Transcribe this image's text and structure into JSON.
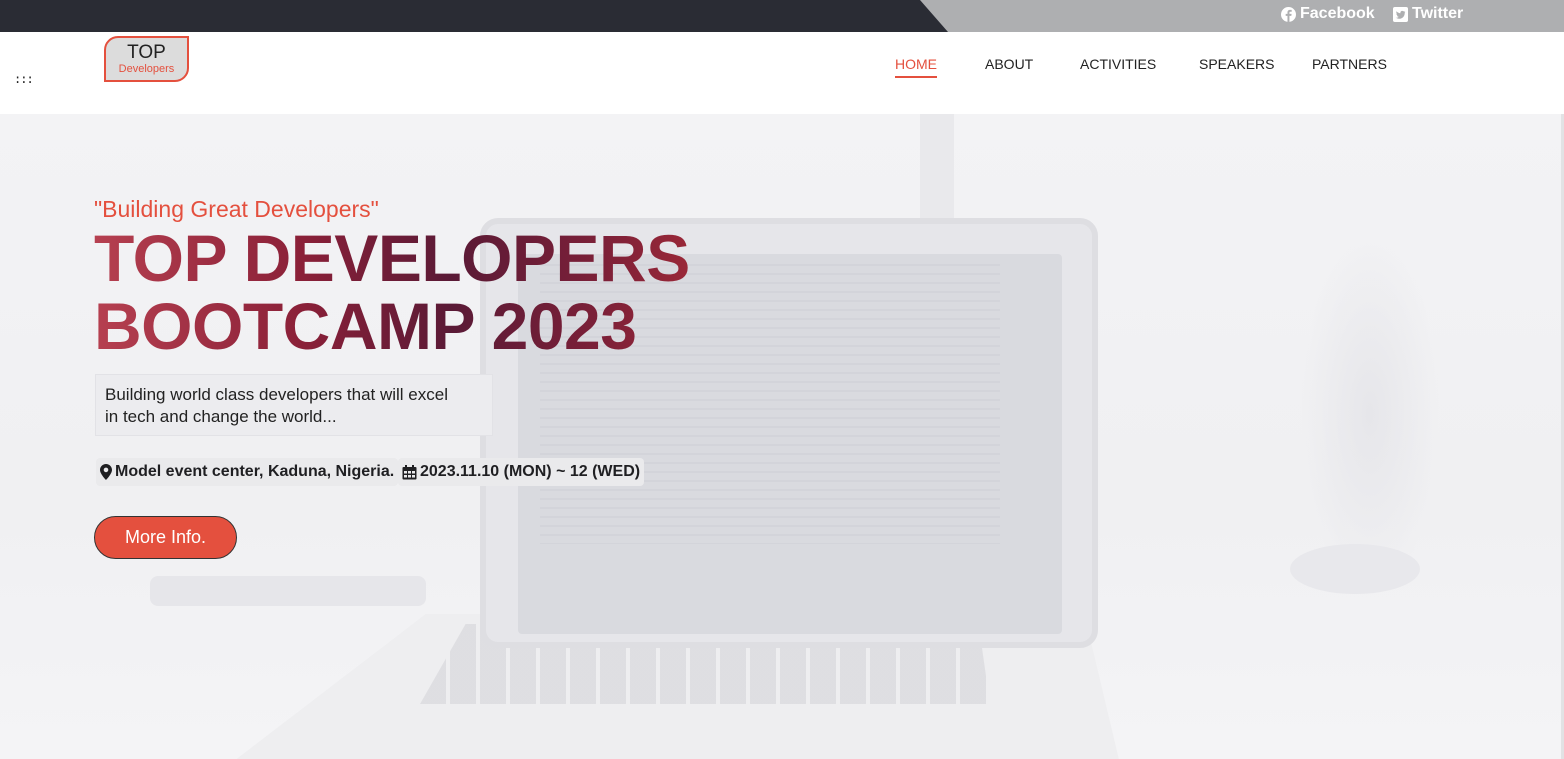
{
  "social": {
    "facebook_label": "Facebook",
    "twitter_label": "Twitter"
  },
  "header": {
    "menu_toggle": ":::",
    "logo_main": "TOP",
    "logo_sub": "Developers",
    "nav": [
      {
        "label": "HOME",
        "active": true
      },
      {
        "label": "ABOUT",
        "active": false
      },
      {
        "label": "ACTIVITIES",
        "active": false
      },
      {
        "label": "SPEAKERS",
        "active": false
      },
      {
        "label": "PARTNERS",
        "active": false
      }
    ]
  },
  "hero": {
    "tagline": "\"Building Great Developers\"",
    "headline_line1": "TOP DEVELOPERS",
    "headline_line2": "BOOTCAMP 2023",
    "description_line1": "Building world class developers that will excel",
    "description_line2": "in tech and change the world...",
    "location": "Model event center, Kaduna, Nigeria.",
    "date": "2023.11.10 (MON) ~ 12 (WED)",
    "cta_label": "More Info."
  },
  "colors": {
    "accent": "#e4503e",
    "topbar_dark": "#2a2c34",
    "topbar_grey": "#aeafb1",
    "headline_gradient_start": "#b64050",
    "headline_gradient_mid": "#5a1a36"
  },
  "icons": {
    "facebook": "facebook-icon",
    "twitter": "twitter-icon",
    "location": "map-marker-icon",
    "date": "calendar-icon"
  }
}
